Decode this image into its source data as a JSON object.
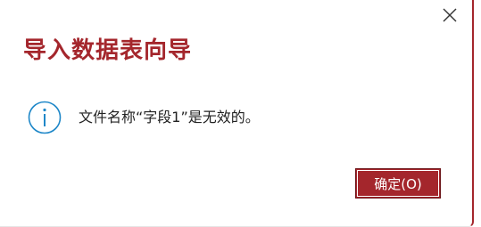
{
  "dialog": {
    "title": "导入数据表向导",
    "message": "文件名称“字段1”是无效的。",
    "ok_label": "确定(O)",
    "icons": {
      "close": "close-icon",
      "info": "info-icon"
    },
    "colors": {
      "accent": "#a4262c",
      "info_icon": "#1e87c8"
    }
  }
}
